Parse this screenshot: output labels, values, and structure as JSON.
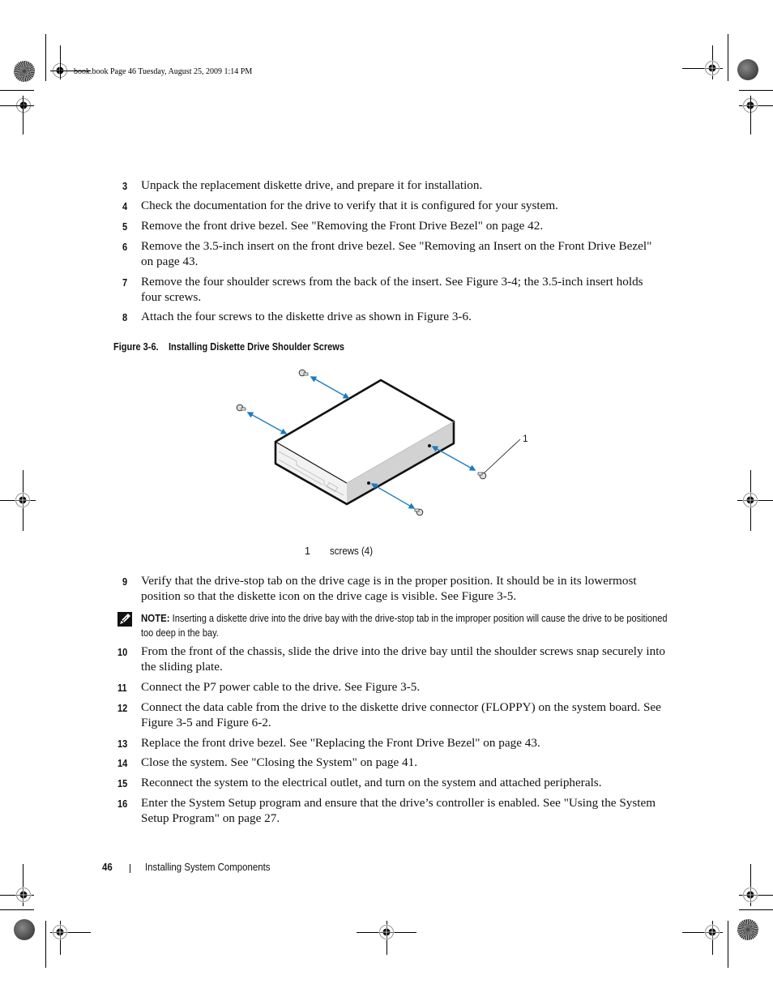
{
  "slug": "book.book  Page 46  Tuesday, August 25, 2009  1:14 PM",
  "steps_before": [
    {
      "num": "3",
      "text": "Unpack the replacement diskette drive, and prepare it for installation."
    },
    {
      "num": "4",
      "text": "Check the documentation for the drive to verify that it is configured for your system."
    },
    {
      "num": "5",
      "text": "Remove the front drive bezel. See \"Removing the Front Drive Bezel\" on page 42."
    },
    {
      "num": "6",
      "text": "Remove the 3.5-inch insert on the front drive bezel. See \"Removing an Insert on the Front Drive Bezel\" on page 43."
    },
    {
      "num": "7",
      "text": "Remove the four shoulder screws from the back of the insert. See Figure 3-4; the 3.5-inch insert holds four screws."
    },
    {
      "num": "8",
      "text": "Attach the four screws to the diskette drive as shown in Figure 3-6."
    }
  ],
  "figure": {
    "label": "Figure 3-6.",
    "title": "Installing Diskette Drive Shoulder Screws",
    "callout": "1",
    "legend": [
      {
        "num": "1",
        "text": "screws (4)"
      }
    ],
    "arrow_color": "#1a7cc1"
  },
  "step9": {
    "num": "9",
    "text": "Verify that the drive-stop tab on the drive cage is in the proper position. It should be in its lowermost position so that the diskette icon on the drive cage is visible. See Figure 3-5."
  },
  "note": {
    "icon": "pencil-note-icon",
    "label": "NOTE:",
    "text": " Inserting a diskette drive into the drive bay with the drive-stop tab in the improper position will cause the drive to be positioned too deep in the bay."
  },
  "steps_after": [
    {
      "num": "10",
      "text": "From the front of the chassis, slide the drive into the drive bay until the shoulder screws snap securely into the sliding plate."
    },
    {
      "num": "11",
      "text": "Connect the P7 power cable to the drive. See Figure 3-5."
    },
    {
      "num": "12",
      "text": "Connect the data cable from the drive to the diskette drive connector (FLOPPY) on the system board. See Figure 3-5 and Figure 6-2."
    },
    {
      "num": "13",
      "text": "Replace the front drive bezel. See \"Replacing the Front Drive Bezel\" on page 43."
    },
    {
      "num": "14",
      "text": "Close the system. See \"Closing the System\" on page 41."
    },
    {
      "num": "15",
      "text": "Reconnect the system to the electrical outlet, and turn on the system and attached peripherals."
    },
    {
      "num": "16",
      "text": "Enter the System Setup program and ensure that the drive’s controller is enabled. See \"Using the System Setup Program\" on page 27."
    }
  ],
  "footer": {
    "page_number": "46",
    "section_title": "Installing System Components"
  }
}
